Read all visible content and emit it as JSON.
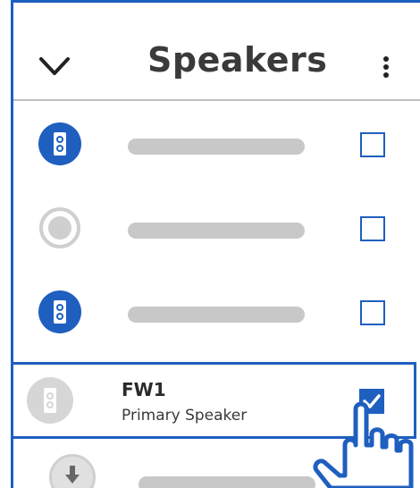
{
  "header": {
    "title": "Speakers",
    "back_icon": "chevron-down-icon",
    "menu_icon": "more-vertical-icon"
  },
  "rows": [
    {
      "avatar": "speaker-icon",
      "avatar_color": "#1f5fbf",
      "checked": false
    },
    {
      "avatar": "radio-icon",
      "avatar_color": "#cfcfcf",
      "checked": false
    },
    {
      "avatar": "speaker-icon",
      "avatar_color": "#1f5fbf",
      "checked": false
    }
  ],
  "selected": {
    "name": "FW1",
    "subtitle": "Primary Speaker",
    "checked": true,
    "avatar": "speaker-icon",
    "avatar_color": "#d6d6d6"
  },
  "colors": {
    "accent": "#1f5fbf",
    "placeholder": "#c8c8c8"
  }
}
